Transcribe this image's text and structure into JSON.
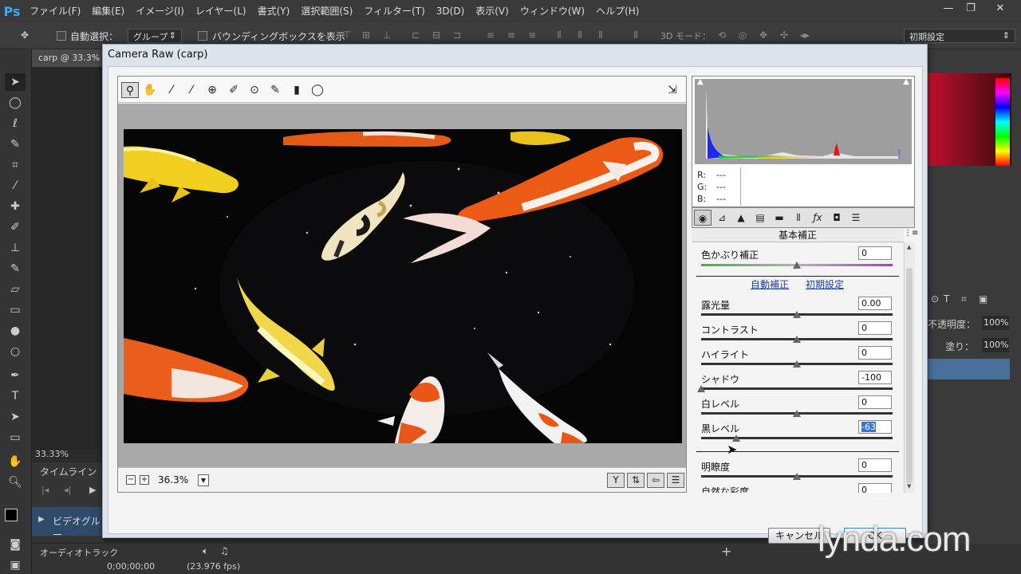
{
  "app": {
    "logo": "Ps"
  },
  "menu": [
    "ファイル(F)",
    "編集(E)",
    "イメージ(I)",
    "レイヤー(L)",
    "書式(Y)",
    "選択範囲(S)",
    "フィルター(T)",
    "3D(D)",
    "表示(V)",
    "ウィンドウ(W)",
    "ヘルプ(H)"
  ],
  "window_controls": {
    "minimize": "—",
    "restore": "❐",
    "close": "✕"
  },
  "options_bar": {
    "auto_select_label": "自動選択：",
    "auto_select_value": "グループ",
    "bounding_box_label": "バウンディングボックスを表示",
    "mode_3d_label": "3D モード：",
    "workspace_value": "初期設定"
  },
  "document": {
    "tab_label": "carp @ 33.3%",
    "zoom_status": "33.33%"
  },
  "dialog": {
    "title": "Camera Raw (carp)",
    "zoom_value": "36.3%",
    "zoom_out": "−",
    "zoom_in": "+",
    "rgb": {
      "r_label": "R:",
      "g_label": "G:",
      "b_label": "B:",
      "r": "---",
      "g": "---",
      "b": "---"
    },
    "panel_title": "基本補正",
    "auto_link": "自動補正",
    "default_link": "初期設定",
    "sliders": [
      {
        "label": "色かぶり補正",
        "value": "0",
        "position": 0.5
      },
      {
        "label": "露光量",
        "value": "0.00",
        "position": 0.5
      },
      {
        "label": "コントラスト",
        "value": "0",
        "position": 0.5
      },
      {
        "label": "ハイライト",
        "value": "0",
        "position": 0.5
      },
      {
        "label": "シャドウ",
        "value": "-100",
        "position": 0.0
      },
      {
        "label": "白レベル",
        "value": "0",
        "position": 0.5
      },
      {
        "label": "黒レベル",
        "value": "-63",
        "position": 0.185
      },
      {
        "label": "明瞭度",
        "value": "0",
        "position": 0.5
      },
      {
        "label": "自然な彩度",
        "value": "0",
        "position": 0.5
      }
    ],
    "cancel_label": "キャンセル",
    "ok_label": "OK"
  },
  "timeline": {
    "panel_label": "タイムライン",
    "video_group": "ビデオグルー",
    "audio_track": "オーディオトラック",
    "timecode": "0;00;00;00",
    "fps": "(23.976 fps)"
  },
  "layers_panel": {
    "opacity_label": "不透明度：",
    "opacity_value": "100%",
    "fill_label": "塗り：",
    "fill_value": "100%"
  },
  "watermark": "lynda.com",
  "colors": {
    "accent_blue": "#3875d7",
    "ps_blue": "#38a9ff",
    "koi_orange": "#ec5a16",
    "koi_yellow": "#f3d21e"
  }
}
